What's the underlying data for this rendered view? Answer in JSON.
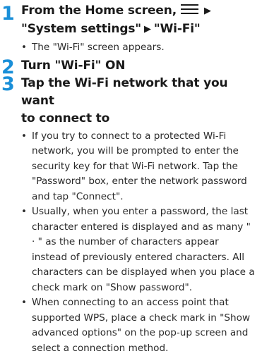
{
  "steps": [
    {
      "number": "1",
      "title_parts": {
        "prefix": "From the Home screen,",
        "arrow1": "▶",
        "line2_a": "\"System settings\"",
        "arrow2": "▶",
        "line2_b": "\"Wi-Fi\""
      },
      "bullets": [
        "The \"Wi-Fi\" screen appears."
      ]
    },
    {
      "number": "2",
      "title": "Turn \"Wi-Fi\" ON",
      "bullets": []
    },
    {
      "number": "3",
      "title_line1": "Tap the Wi-Fi network that you want",
      "title_line2": "to connect to",
      "bullets": [
        "If you try to connect to a protected Wi-Fi network, you will be prompted to enter the security key for that Wi-Fi network. Tap the \"Password\" box, enter the network password and tap \"Connect\".",
        "Usually, when you enter a password, the last character entered is displayed and as many \" · \" as the number of characters appear instead of previously entered characters. All characters can be displayed when you place a check mark on \"Show password\".",
        "When connecting to an access point that supported WPS, place a check mark in \"Show advanced options\" on the pop-up screen and select a connection method."
      ]
    }
  ],
  "bullet_char": "•",
  "icons": {
    "menu": "menu-icon"
  },
  "colors": {
    "step_number": "#1a8fd8",
    "text": "#1a1a1a"
  }
}
